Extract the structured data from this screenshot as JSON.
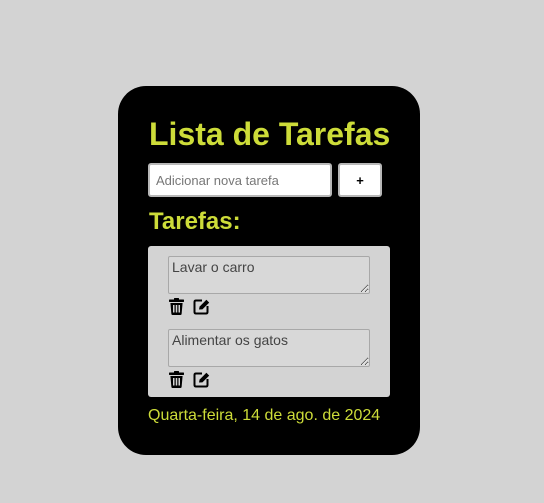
{
  "app": {
    "title": "Lista de Tarefas",
    "accent_color": "#cddc39",
    "card_color": "#000000",
    "background_color": "#d3d3d3"
  },
  "new_task": {
    "placeholder": "Adicionar nova tarefa",
    "value": "",
    "add_label": "+"
  },
  "tasks_heading": "Tarefas:",
  "tasks": [
    {
      "text": "Lavar o carro",
      "delete_icon": "trash-icon",
      "edit_icon": "edit-icon"
    },
    {
      "text": "Alimentar os gatos",
      "delete_icon": "trash-icon",
      "edit_icon": "edit-icon"
    }
  ],
  "date": "Quarta-feira, 14 de ago. de 2024"
}
